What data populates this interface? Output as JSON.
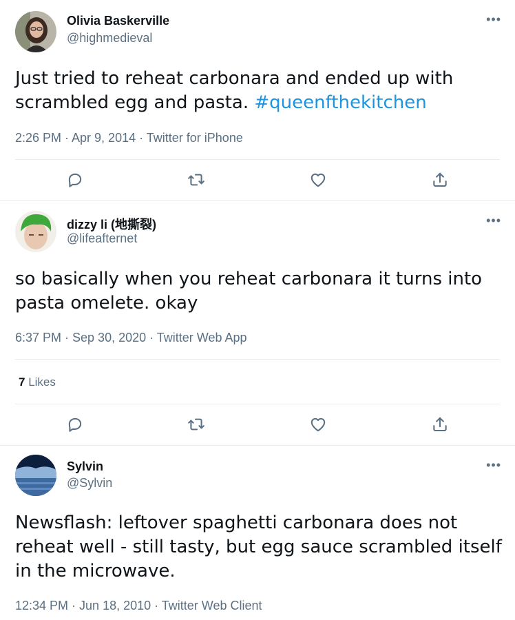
{
  "tweets": [
    {
      "name": "Olivia Baskerville",
      "handle": "@highmedieval",
      "text": "Just tried to reheat carbonara and ended up with scrambled egg and pasta. ",
      "hashtag": "#queenfthekitchen",
      "time": "2:26 PM · Apr 9, 2014 · Twitter for iPhone"
    },
    {
      "name": "dizzy li (地撕裂)",
      "handle": "@lifeafternet",
      "text": "so basically when you reheat carbonara it turns into pasta omelete. okay",
      "time": "6:37 PM · Sep 30, 2020 · Twitter Web App",
      "likes_count": "7",
      "likes_label": "Likes"
    },
    {
      "name": "Sylvin",
      "handle": "@Sylvin",
      "text": "Newsflash: leftover spaghetti carbonara does not reheat well - still tasty, but egg sauce scrambled itself in the microwave.",
      "time": "12:34 PM · Jun 18, 2010 · Twitter Web Client"
    }
  ],
  "more_label": "•••",
  "icons": [
    "reply-icon",
    "retweet-icon",
    "like-icon",
    "share-icon"
  ],
  "colors": {
    "link": "#1b95e0",
    "secondary": "#5b7083",
    "text": "#0f1419",
    "border": "#e6ecf0"
  }
}
